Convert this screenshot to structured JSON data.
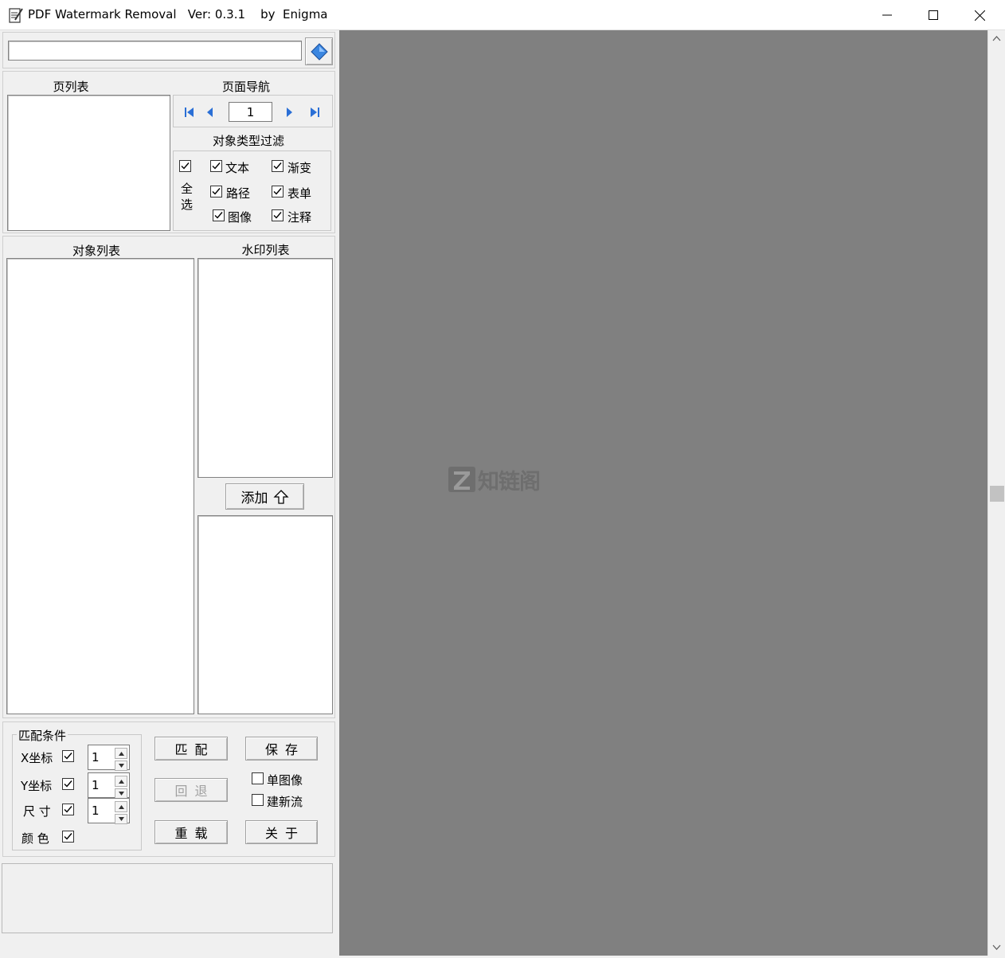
{
  "window": {
    "title": "PDF Watermark Removal   Ver: 0.3.1    by  Enigma",
    "min_glyph": "—",
    "max_glyph": "☐",
    "close_glyph": "✕"
  },
  "toolbar": {
    "path_value": "",
    "open_icon": "open-file-icon"
  },
  "page_list": {
    "title": "页列表"
  },
  "page_nav": {
    "title": "页面导航",
    "page_value": "1"
  },
  "type_filter": {
    "title": "对象类型过滤",
    "select_all_label": "全\n选",
    "select_all_line1": "全",
    "select_all_line2": "选",
    "items": [
      {
        "label": "文本",
        "checked": true
      },
      {
        "label": "渐变",
        "checked": true
      },
      {
        "label": "路径",
        "checked": true
      },
      {
        "label": "表单",
        "checked": true
      },
      {
        "label": "图像",
        "checked": true
      },
      {
        "label": "注释",
        "checked": true
      }
    ]
  },
  "object_list": {
    "title": "对象列表"
  },
  "watermark_list": {
    "title": "水印列表"
  },
  "add_button": {
    "label": "添加"
  },
  "match_conditions": {
    "title": "匹配条件",
    "x_label": "X坐标",
    "y_label": "Y坐标",
    "size_label": "尺 寸",
    "color_label": "颜 色",
    "x_value": "1",
    "y_value": "1",
    "size_value": "1"
  },
  "actions": {
    "match": "匹配",
    "save": "保存",
    "undo": "回退",
    "reload": "重载",
    "about": "关于",
    "single_image": "单图像",
    "new_stream": "建新流"
  },
  "viewer": {
    "watermark_text": "知链阁"
  },
  "colors": {
    "viewer_bg": "#808080",
    "nav_arrow": "#2a6fd6"
  }
}
